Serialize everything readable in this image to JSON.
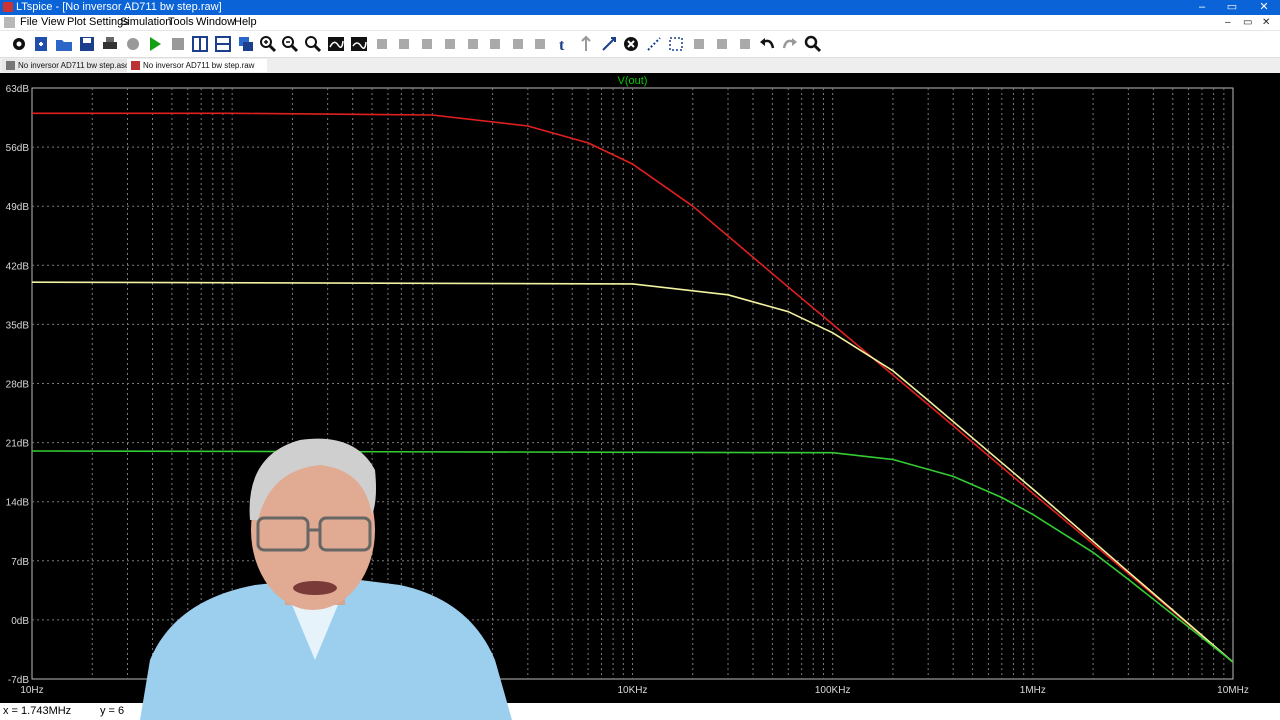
{
  "window": {
    "title": "LTspice - [No inversor AD711 bw step.raw]",
    "controls": [
      "–",
      "▭",
      "✕"
    ],
    "mdi_controls": [
      "–",
      "▭",
      "✕"
    ]
  },
  "menu": [
    "File",
    "View",
    "Plot Settings",
    "Simulation",
    "Tools",
    "Window",
    "Help"
  ],
  "toolbar": [
    {
      "icon": "gear-icon"
    },
    {
      "icon": "new-schematic-icon"
    },
    {
      "icon": "open-folder-icon"
    },
    {
      "icon": "save-icon"
    },
    {
      "icon": "print-icon"
    },
    {
      "icon": "control-panel-icon"
    },
    {
      "icon": "run-icon"
    },
    {
      "icon": "halt-icon"
    },
    {
      "icon": "tile-vertical-icon"
    },
    {
      "icon": "tile-horizontal-icon"
    },
    {
      "icon": "cascade-icon"
    },
    {
      "icon": "zoom-in-icon"
    },
    {
      "icon": "zoom-out-icon"
    },
    {
      "icon": "zoom-fit-icon"
    },
    {
      "icon": "autorange-icon"
    },
    {
      "icon": "delete-trace-icon"
    },
    {
      "icon": "wire-icon"
    },
    {
      "icon": "ground-icon"
    },
    {
      "icon": "label-icon"
    },
    {
      "icon": "resistor-icon"
    },
    {
      "icon": "capacitor-icon"
    },
    {
      "icon": "inductor-icon"
    },
    {
      "icon": "diode-icon"
    },
    {
      "icon": "component-icon"
    },
    {
      "icon": "spice-directive-icon"
    },
    {
      "icon": "text-icon"
    },
    {
      "icon": "move-icon"
    },
    {
      "icon": "delete-icon"
    },
    {
      "icon": "duplicate-icon"
    },
    {
      "icon": "drag-icon"
    },
    {
      "icon": "rotate-icon"
    },
    {
      "icon": "mirror-icon"
    },
    {
      "icon": "paste-icon"
    },
    {
      "icon": "undo-icon"
    },
    {
      "icon": "redo-icon"
    },
    {
      "icon": "find-icon"
    }
  ],
  "tabs": [
    {
      "label": "No inversor AD711 bw step.asc"
    },
    {
      "label": "No inversor AD711 bw step.raw"
    }
  ],
  "plot": {
    "trace_label": "V(out)",
    "trace_label_color": "#00cc00"
  },
  "status": {
    "x_readout": "x = 1.743MHz",
    "y_readout": "y = 6"
  },
  "chart_data": {
    "type": "line",
    "xscale": "log",
    "xlim": [
      10,
      10000000
    ],
    "ylim": [
      -7,
      63
    ],
    "x_ticks": [
      "10Hz",
      "",
      "",
      "10KHz",
      "100KHz",
      "1MHz",
      "10MHz"
    ],
    "x_tick_values": [
      10,
      100,
      1000,
      10000,
      100000,
      1000000,
      10000000
    ],
    "y_ticks": [
      "63dB",
      "56dB",
      "49dB",
      "42dB",
      "35dB",
      "28dB",
      "21dB",
      "14dB",
      "7dB",
      "0dB",
      "-7dB"
    ],
    "y_tick_values": [
      63,
      56,
      49,
      42,
      35,
      28,
      21,
      14,
      7,
      0,
      -7
    ],
    "grid": true,
    "series": [
      {
        "color": "#e02020",
        "x": [
          10,
          100,
          1000,
          3000,
          6000,
          10000,
          20000,
          50000,
          100000,
          300000,
          1000000,
          3000000,
          10000000
        ],
        "y": [
          60,
          60,
          59.8,
          58.5,
          56.5,
          54,
          49,
          41,
          35,
          25.5,
          15,
          5.5,
          -5
        ]
      },
      {
        "color": "#f2f2a0",
        "x": [
          10,
          10000,
          30000,
          60000,
          100000,
          200000,
          300000,
          1000000,
          3000000,
          10000000
        ],
        "y": [
          40,
          39.8,
          38.5,
          36.5,
          34,
          29.5,
          26,
          15.5,
          5.7,
          -5
        ]
      },
      {
        "color": "#33cc33",
        "x": [
          10,
          100000,
          200000,
          400000,
          700000,
          1000000,
          2000000,
          3000000,
          10000000
        ],
        "y": [
          20,
          19.8,
          19,
          17,
          14.5,
          12.5,
          8,
          4.8,
          -5
        ]
      }
    ]
  }
}
